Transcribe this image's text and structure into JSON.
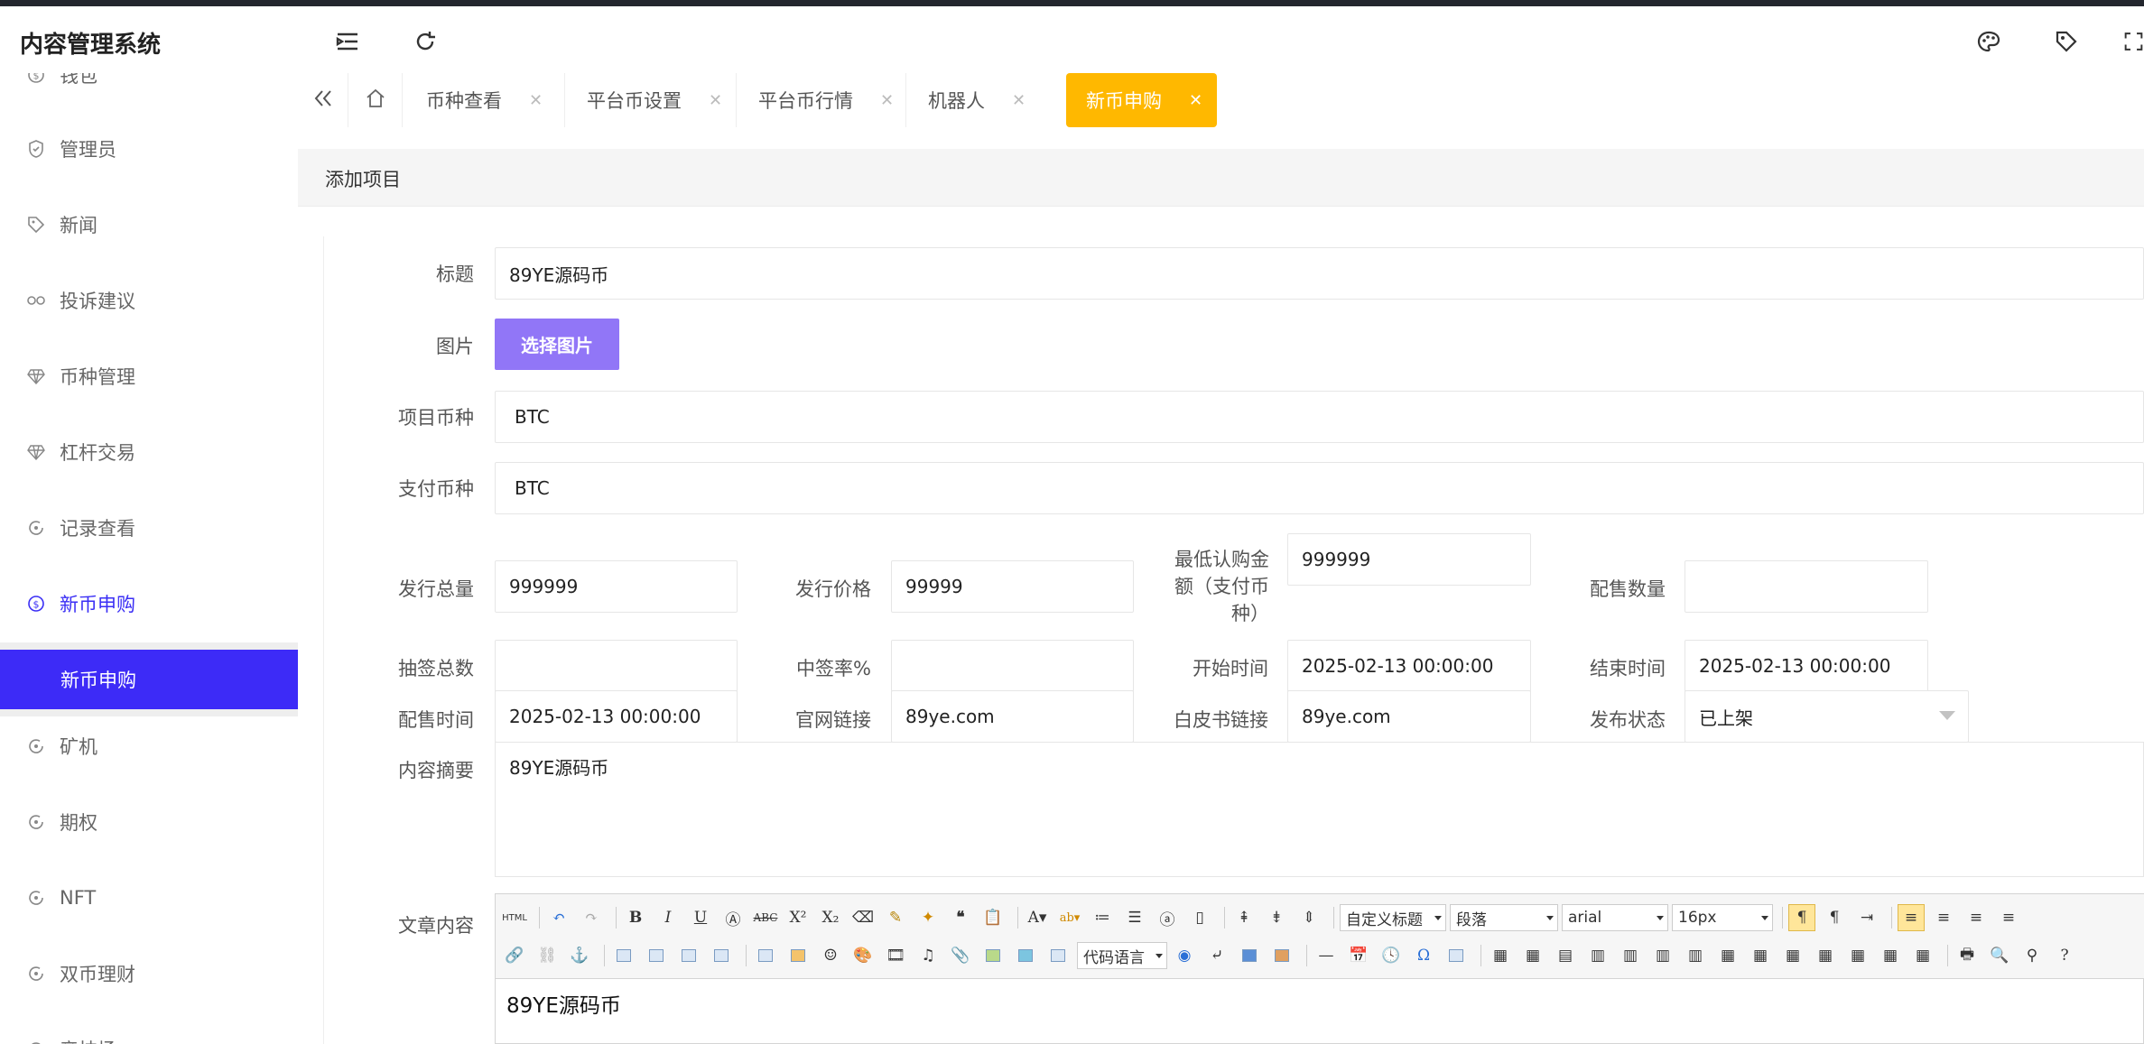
{
  "app": {
    "title": "内容管理系统"
  },
  "sidebar": {
    "items": [
      {
        "label": "钱包"
      },
      {
        "label": "管理员"
      },
      {
        "label": "新闻"
      },
      {
        "label": "投诉建议"
      },
      {
        "label": "币种管理"
      },
      {
        "label": "杠杆交易"
      },
      {
        "label": "记录查看"
      },
      {
        "label": "新币申购"
      },
      {
        "label": "矿机"
      },
      {
        "label": "期权"
      },
      {
        "label": "NFT"
      },
      {
        "label": "双币理财"
      },
      {
        "label": "竞技场"
      }
    ],
    "sub_item": {
      "label": "新币申购"
    },
    "active_color": "#3d2bf7"
  },
  "tabs": [
    {
      "label": "币种查看"
    },
    {
      "label": "平台币设置"
    },
    {
      "label": "平台币行情"
    },
    {
      "label": "机器人"
    },
    {
      "label": "新币申购",
      "active": true,
      "color": "#ffb800"
    }
  ],
  "breadcrumb": "添加项目",
  "form": {
    "title": {
      "label": "标题",
      "value": "89YE源码币"
    },
    "image": {
      "label": "图片",
      "button": "选择图片"
    },
    "project_coin": {
      "label": "项目币种",
      "value": "BTC"
    },
    "pay_coin": {
      "label": "支付币种",
      "value": "BTC"
    },
    "total_issue": {
      "label": "发行总量",
      "value": "999999"
    },
    "issue_price": {
      "label": "发行价格",
      "value": "99999"
    },
    "min_amount": {
      "label_line1": "最低认购金",
      "label_line2": "额（支付币",
      "label_line3": "种）",
      "value": "999999"
    },
    "allot_qty": {
      "label": "配售数量",
      "value": ""
    },
    "lottery_total": {
      "label": "抽签总数",
      "value": ""
    },
    "win_rate": {
      "label": "中签率%",
      "value": ""
    },
    "start_time": {
      "label": "开始时间",
      "value": "2025-02-13 00:00:00"
    },
    "end_time": {
      "label": "结束时间",
      "value": "2025-02-13 00:00:00"
    },
    "allot_time": {
      "label": "配售时间",
      "value": "2025-02-13 00:00:00"
    },
    "website": {
      "label": "官网链接",
      "value": "89ye.com"
    },
    "whitepaper": {
      "label": "白皮书链接",
      "value": "89ye.com"
    },
    "status": {
      "label": "发布状态",
      "value": "已上架"
    },
    "summary": {
      "label": "内容摘要",
      "value": "89YE源码币"
    },
    "article": {
      "label": "文章内容",
      "value": "89YE源码币"
    }
  },
  "editor": {
    "html_label": "HTML",
    "custom_title": "自定义标题",
    "paragraph": "段落",
    "font": "arial",
    "size": "16px",
    "code_lang": "代码语言"
  },
  "accent_purple": "#9176f7"
}
